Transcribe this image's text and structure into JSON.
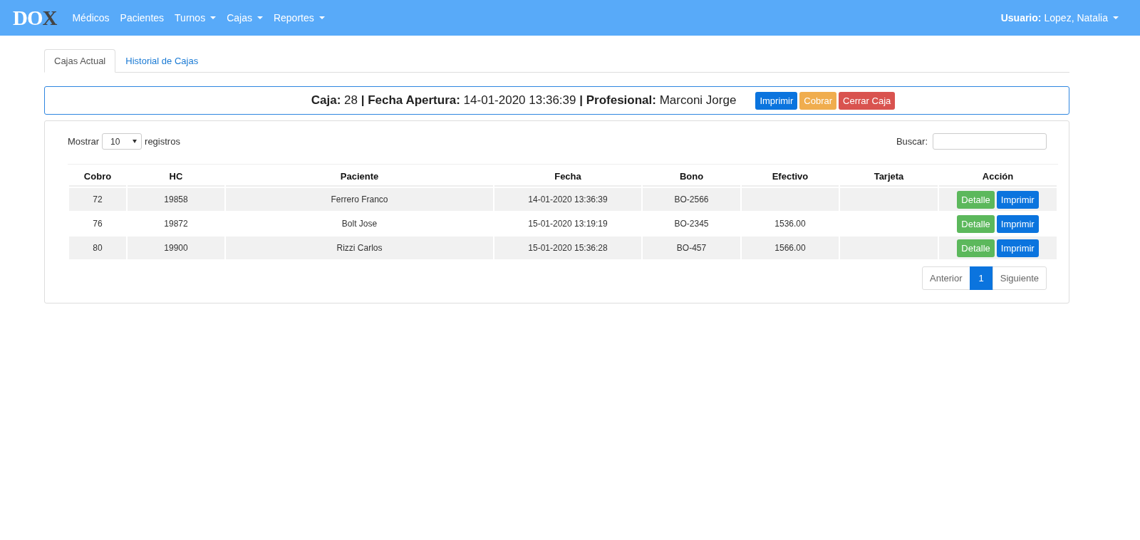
{
  "navbar": {
    "logo": [
      "DO",
      "X"
    ],
    "items": [
      {
        "label": "Médicos",
        "dropdown": false
      },
      {
        "label": "Pacientes",
        "dropdown": false
      },
      {
        "label": "Turnos",
        "dropdown": true
      },
      {
        "label": "Cajas",
        "dropdown": true
      },
      {
        "label": "Reportes",
        "dropdown": true
      }
    ],
    "user": {
      "label": "Usuario:",
      "name": "Lopez, Natalia",
      "dropdown": true
    }
  },
  "tabs": [
    {
      "label": "Cajas Actual",
      "selected": true
    },
    {
      "label": "Historial de Cajas",
      "selected": false
    }
  ],
  "caja_header": {
    "summary": "**Caja:** 28 **|** **Fecha Apertura:** 14-01-2020 13:36:39 **|** **Profesional:** Marconi Jorge",
    "buttons": [
      {
        "label": "Imprimir",
        "kind": "primary"
      },
      {
        "label": "Cobrar",
        "kind": "warning"
      },
      {
        "label": "Cerrar Caja",
        "kind": "danger"
      }
    ]
  },
  "length_control": {
    "prefix": "Mostrar",
    "value": "10",
    "suffix": "registros"
  },
  "search": {
    "label": "Buscar:"
  },
  "table": {
    "columns": [
      "Cobro",
      "HC",
      "Paciente",
      "Fecha",
      "Bono",
      "Efectivo",
      "Tarjeta",
      "Acción"
    ],
    "rows": [
      {
        "cobro": "72",
        "hc": "19858",
        "paciente": "Ferrero Franco",
        "fecha": "14-01-2020 13:36:39",
        "bono": "BO-2566",
        "actions": [
          {
            "label": "Detalle",
            "kind": "success"
          },
          {
            "label": "Imprimir",
            "kind": "primary"
          }
        ]
      },
      {
        "cobro": "76",
        "hc": "19872",
        "paciente": "Bolt Jose",
        "fecha": "15-01-2020 13:19:19",
        "bono": "BO-2345",
        "efectivo": "1536.00",
        "actions": [
          {
            "label": "Detalle",
            "kind": "success"
          },
          {
            "label": "Imprimir",
            "kind": "primary"
          }
        ]
      },
      {
        "cobro": "80",
        "hc": "19900",
        "paciente": "Rizzi Carlos",
        "fecha": "15-01-2020 15:36:28",
        "bono": "BO-457",
        "efectivo": "1566.00",
        "actions": [
          {
            "label": "Detalle",
            "kind": "success"
          },
          {
            "label": "Imprimir",
            "kind": "primary"
          }
        ]
      }
    ]
  },
  "pagination": [
    {
      "label": "Anterior",
      "selected": false
    },
    {
      "label": "1",
      "selected": true
    },
    {
      "label": "Siguiente",
      "selected": false
    }
  ]
}
